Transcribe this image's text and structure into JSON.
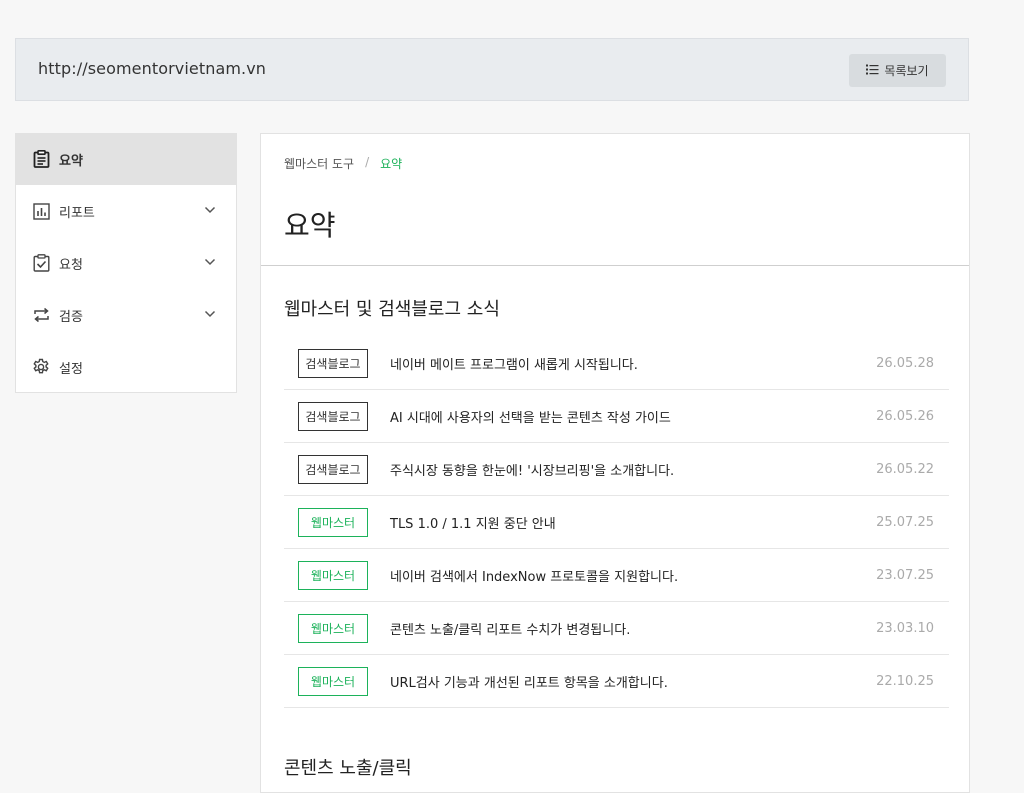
{
  "header": {
    "site_url": "http://seomentorvietnam.vn",
    "list_button_label": "목록보기"
  },
  "sidebar": {
    "items": [
      {
        "label": "요약",
        "icon": "clipboard-icon",
        "active": true
      },
      {
        "label": "리포트",
        "icon": "bar-chart-icon",
        "expandable": true
      },
      {
        "label": "요청",
        "icon": "checklist-icon",
        "expandable": true
      },
      {
        "label": "검증",
        "icon": "repeat-icon",
        "expandable": true
      },
      {
        "label": "설정",
        "icon": "gear-icon"
      }
    ]
  },
  "main": {
    "breadcrumb": {
      "root": "웹마스터 도구",
      "separator": "/",
      "current": "요약"
    },
    "title": "요약",
    "news_section_title": "웹마스터 및 검색블로그 소식",
    "news": [
      {
        "tag": "검색블로그",
        "tag_style": "dark",
        "title": "네이버 메이트 프로그램이 새롭게 시작됩니다.",
        "date": "26.05.28"
      },
      {
        "tag": "검색블로그",
        "tag_style": "dark",
        "title": "AI 시대에 사용자의 선택을 받는 콘텐츠 작성 가이드",
        "date": "26.05.26"
      },
      {
        "tag": "검색블로그",
        "tag_style": "dark",
        "title": "주식시장 동향을 한눈에! '시장브리핑'을 소개합니다.",
        "date": "26.05.22"
      },
      {
        "tag": "웹마스터",
        "tag_style": "green",
        "title": "TLS 1.0 / 1.1 지원 중단 안내",
        "date": "25.07.25"
      },
      {
        "tag": "웹마스터",
        "tag_style": "green",
        "title": "네이버 검색에서 IndexNow 프로토콜을 지원합니다.",
        "date": "23.07.25"
      },
      {
        "tag": "웹마스터",
        "tag_style": "green",
        "title": "콘텐츠 노출/클릭 리포트 수치가 변경됩니다.",
        "date": "23.03.10"
      },
      {
        "tag": "웹마스터",
        "tag_style": "green",
        "title": "URL검사 기능과 개선된 리포트 항목을 소개합니다.",
        "date": "22.10.25"
      }
    ],
    "exposure_section_title": "콘텐츠 노출/클릭"
  },
  "colors": {
    "accent_green": "#1cb25a",
    "active_bg": "#e2e2e2",
    "header_bg": "#e9ecef"
  }
}
